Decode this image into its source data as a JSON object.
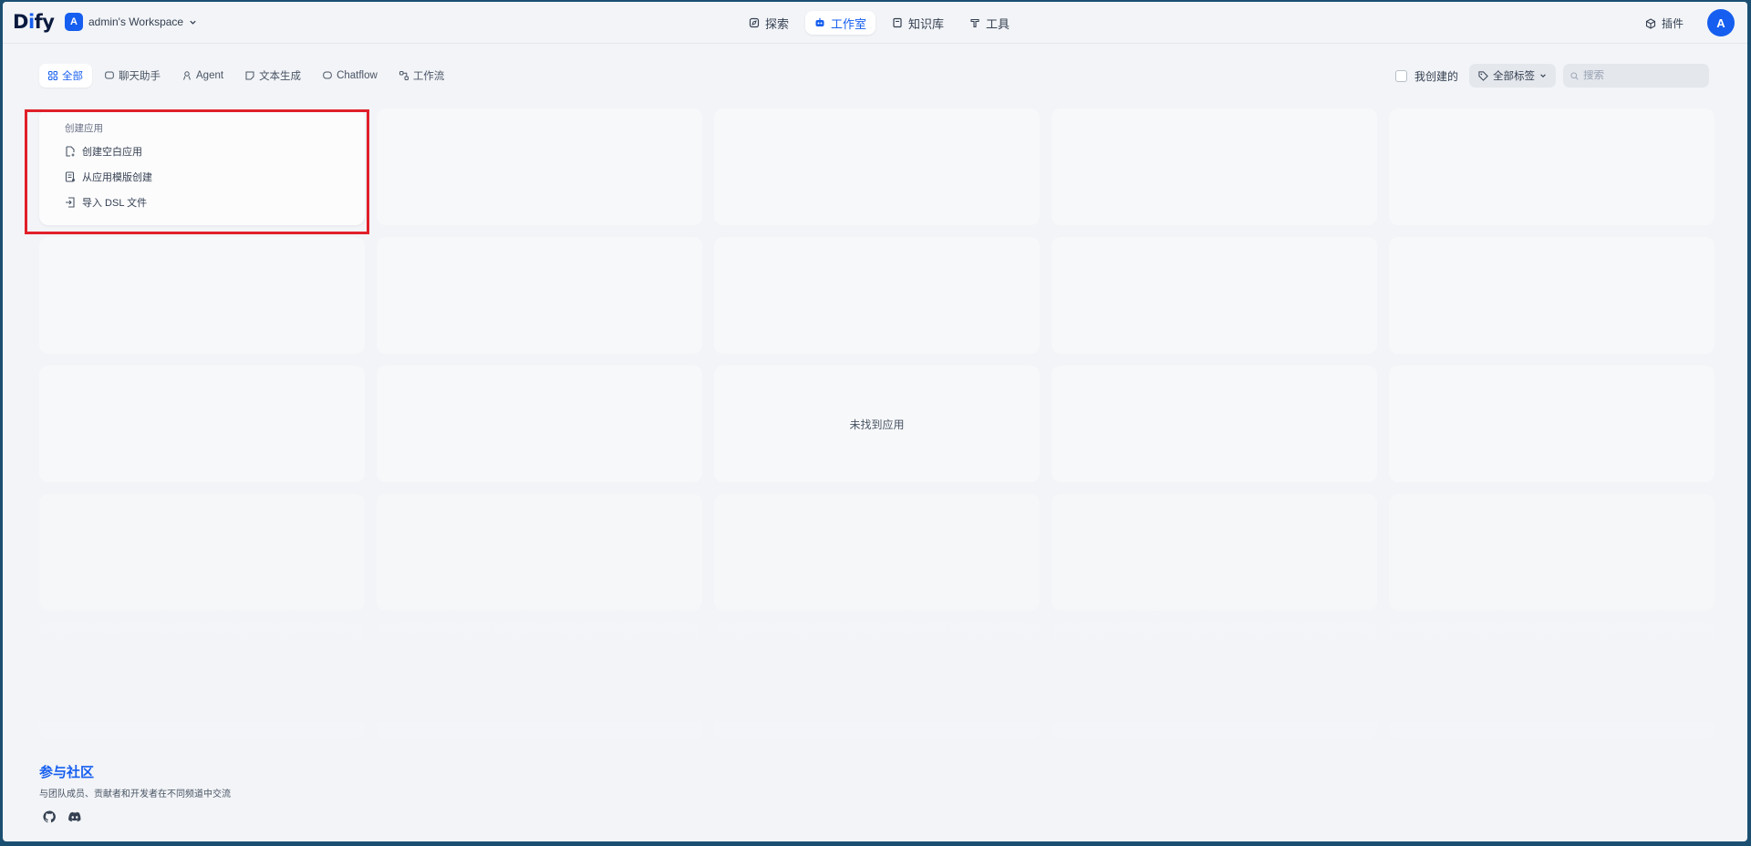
{
  "header": {
    "logo_prefix": "D",
    "logo_i": "i",
    "logo_suffix": "fy",
    "workspace_initial": "A",
    "workspace_name": "admin's Workspace",
    "nav": [
      {
        "label": "探索",
        "icon": "compass-icon"
      },
      {
        "label": "工作室",
        "icon": "robot-icon",
        "active": true
      },
      {
        "label": "知识库",
        "icon": "book-icon"
      },
      {
        "label": "工具",
        "icon": "hammer-icon"
      }
    ],
    "plugin_label": "插件",
    "user_initial": "A"
  },
  "filters": {
    "tabs": [
      {
        "label": "全部",
        "icon": "grid-icon",
        "active": true
      },
      {
        "label": "聊天助手",
        "icon": "chat-icon"
      },
      {
        "label": "Agent",
        "icon": "agent-icon"
      },
      {
        "label": "文本生成",
        "icon": "document-icon"
      },
      {
        "label": "Chatflow",
        "icon": "chatflow-icon"
      },
      {
        "label": "工作流",
        "icon": "workflow-icon"
      }
    ],
    "mine_label": "我创建的",
    "tag_select_label": "全部标签",
    "search_placeholder": "搜索"
  },
  "create_card": {
    "title": "创建应用",
    "items": [
      {
        "label": "创建空白应用",
        "icon": "file-plus-icon"
      },
      {
        "label": "从应用模版创建",
        "icon": "template-icon"
      },
      {
        "label": "导入 DSL 文件",
        "icon": "import-icon"
      }
    ]
  },
  "empty_message": "未找到应用",
  "community": {
    "title": "参与社区",
    "subtitle": "与团队成员、贡献者和开发者在不同频道中交流",
    "links": [
      {
        "icon": "github-icon"
      },
      {
        "icon": "discord-icon"
      }
    ]
  },
  "colors": {
    "accent": "#155eef",
    "highlight_border": "#e0202a",
    "background": "#f2f4f7"
  }
}
